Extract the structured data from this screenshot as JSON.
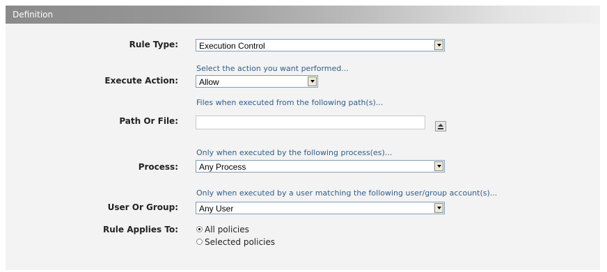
{
  "section": {
    "title": "Definition"
  },
  "rule_type": {
    "label": "Rule Type:",
    "value": "Execution Control"
  },
  "execute_action": {
    "label": "Execute Action:",
    "hint": "Select the action you want performed...",
    "value": "Allow"
  },
  "path_or_file": {
    "label": "Path Or File:",
    "hint": "Files when executed from the following path(s)...",
    "value": ""
  },
  "process": {
    "label": "Process:",
    "hint": "Only when executed by the following process(es)...",
    "value": "Any Process"
  },
  "user_or_group": {
    "label": "User Or Group:",
    "hint": "Only when executed by a user matching the following user/group account(s)...",
    "value": "Any User"
  },
  "rule_applies_to": {
    "label": "Rule Applies To:",
    "options": [
      {
        "label": "All policies",
        "checked": true
      },
      {
        "label": "Selected policies",
        "checked": false
      }
    ]
  }
}
